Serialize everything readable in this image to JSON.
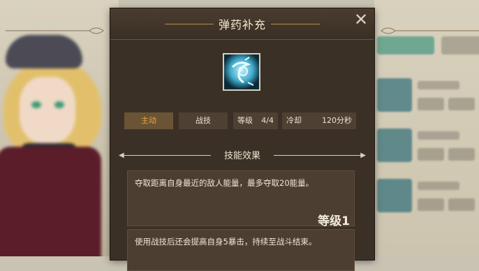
{
  "dialog": {
    "title": "弹药补充",
    "close_icon": "close-icon"
  },
  "skill": {
    "icon": "ammo-refill-skill-icon",
    "tags": {
      "type": "主动",
      "category": "战技",
      "level_label": "等级",
      "level_value": "4/4",
      "cooldown_label": "冷却",
      "cooldown_value": "120分秒"
    }
  },
  "effects": {
    "section_title": "技能效果",
    "items": [
      {
        "text": "夺取距离自身最近的敌人能量，最多夺取20能量。",
        "level": "等级1"
      },
      {
        "text": "使用战技后还会提高自身5暴击，持续至战斗结束。",
        "level": ""
      }
    ]
  },
  "colors": {
    "panel_bg": "#3b3026",
    "accent_gold": "#f0a33b",
    "text": "#efe6d3"
  }
}
